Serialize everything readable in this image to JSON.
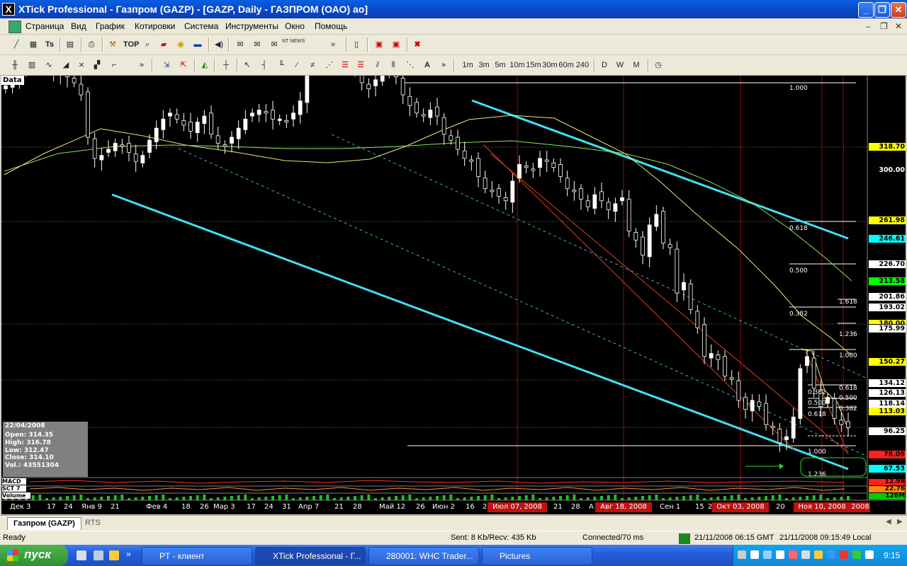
{
  "window": {
    "title": "XTick Professional - Газпром (GAZP) - [GAZP, Daily - ГАЗПРОМ (ОАО) ао]",
    "app_icon": "X"
  },
  "menu": [
    "Страница",
    "Вид",
    "График",
    "Котировки",
    "Система",
    "Инструменты",
    "Окно",
    "Помощь"
  ],
  "toolbar1": {
    "top_label": "TOP",
    "news_label": "NT NEWS"
  },
  "timeframes": [
    "1m",
    "3m",
    "5m",
    "10m",
    "15m",
    "30m",
    "60m",
    "240",
    "D",
    "W",
    "M"
  ],
  "chart": {
    "panel_label": "Data",
    "info": {
      "date": "22/04/2008",
      "open": "Open: 314.35",
      "high": "High: 316.78",
      "low": "Low: 312.47",
      "close": "Close: 314.10",
      "vol": "Vol.: 43551304"
    },
    "price_tags": [
      {
        "text": "318.70",
        "bg": "#ffff00",
        "fg": "#000000"
      },
      {
        "text": "300.00",
        "bg": "#000000",
        "fg": "#ffffff"
      },
      {
        "text": "261.98",
        "bg": "#ffff00",
        "fg": "#000000"
      },
      {
        "text": "246.61",
        "bg": "#00ffff",
        "fg": "#000000"
      },
      {
        "text": "226.70",
        "bg": "#ffffff",
        "fg": "#000000"
      },
      {
        "text": "213.58",
        "bg": "#00ff00",
        "fg": "#000000"
      },
      {
        "text": "201.86",
        "bg": "#ffffff",
        "fg": "#000000"
      },
      {
        "text": "193.02",
        "bg": "#ffffff",
        "fg": "#000000"
      },
      {
        "text": "180.00",
        "bg": "#ffff00",
        "fg": "#000000"
      },
      {
        "text": "175.99",
        "bg": "#ffffff",
        "fg": "#000000"
      },
      {
        "text": "150.27",
        "bg": "#ffff00",
        "fg": "#000000"
      },
      {
        "text": "134.12",
        "bg": "#ffffff",
        "fg": "#000000"
      },
      {
        "text": "126.13",
        "bg": "#ffffff",
        "fg": "#000000"
      },
      {
        "text": "118.14",
        "bg": "#ffffff",
        "fg": "#000000"
      },
      {
        "text": "113.03",
        "bg": "#ffff00",
        "fg": "#000000"
      },
      {
        "text": "96.25",
        "bg": "#ffffff",
        "fg": "#000000"
      },
      {
        "text": "78.09",
        "bg": "#ff2020",
        "fg": "#000000"
      },
      {
        "text": "67.53",
        "bg": "#00ffff",
        "fg": "#000000"
      }
    ],
    "indicator_labels": [
      "MACD",
      "SCT 7",
      "Volume"
    ],
    "indicator_values": [
      {
        "text": "12.98",
        "bg": "#ff2020"
      },
      {
        "text": "22.76",
        "bg": "#ff8800"
      },
      {
        "text": "126M",
        "bg": "#00cc00"
      }
    ],
    "fib_labels": [
      "1.000",
      "0.618",
      "0.500",
      "0.382",
      "1.618",
      "1.236",
      "1.000",
      "0.618",
      "0.500",
      "0.382",
      "0.382",
      "0.500",
      "0.618",
      "1.000",
      "1.236"
    ],
    "x_labels": [
      "Дек 3",
      "17",
      "24",
      "Янв 9",
      "21",
      "Фев 4",
      "18",
      "26",
      "Мар 3",
      "17",
      "24",
      "31",
      "Апр 7",
      "21",
      "28",
      "Май 12",
      "26",
      "Июн 2",
      "16",
      "2",
      "Июл 07, 2008",
      "21",
      "28",
      "А",
      "Авг 18, 2008",
      "Сен 1",
      "15",
      "2",
      "Окт 03, 2008",
      "20",
      "Ноя 10, 2008",
      "2008"
    ],
    "closes": [
      318,
      322,
      328,
      334,
      336,
      332,
      330,
      326,
      330,
      324,
      320,
      312,
      284,
      270,
      272,
      276,
      280,
      278,
      274,
      268,
      272,
      282,
      290,
      296,
      300,
      296,
      292,
      288,
      294,
      298,
      286,
      280,
      278,
      284,
      290,
      296,
      300,
      302,
      300,
      296,
      296,
      294,
      300,
      308,
      336,
      338,
      344,
      346,
      340,
      334,
      330,
      328,
      320,
      316,
      322,
      328,
      332,
      324,
      312,
      305,
      300,
      298,
      302,
      298,
      286,
      282,
      276,
      270,
      268,
      258,
      250,
      248,
      245,
      242,
      255,
      266,
      264,
      262,
      270,
      268,
      264,
      258,
      250,
      248,
      243,
      238,
      246,
      242,
      236,
      240,
      244,
      222,
      216,
      206,
      226,
      233,
      214,
      211,
      181,
      188,
      170,
      158,
      139,
      141,
      137,
      126,
      124,
      110,
      104,
      110,
      106,
      94,
      92,
      82,
      86,
      99,
      131,
      139,
      118,
      106,
      112,
      98,
      94,
      92
    ]
  },
  "tabs": {
    "active": "Газпром (GAZP)",
    "other": "RTS"
  },
  "status": {
    "ready": "Ready",
    "traffic": "Sent: 8 Kb/Recv: 435 Kb",
    "conn": "Connected/70 ms",
    "gmt": "21/11/2008 06:15 GMT",
    "local": "21/11/2008 09:15:49 Local"
  },
  "taskbar": {
    "start": "пуск",
    "tasks": [
      "PT - клиент",
      "XTick Professional - Г...",
      "280001: WHC Trader...",
      "Pictures"
    ],
    "clock": "9:15"
  }
}
